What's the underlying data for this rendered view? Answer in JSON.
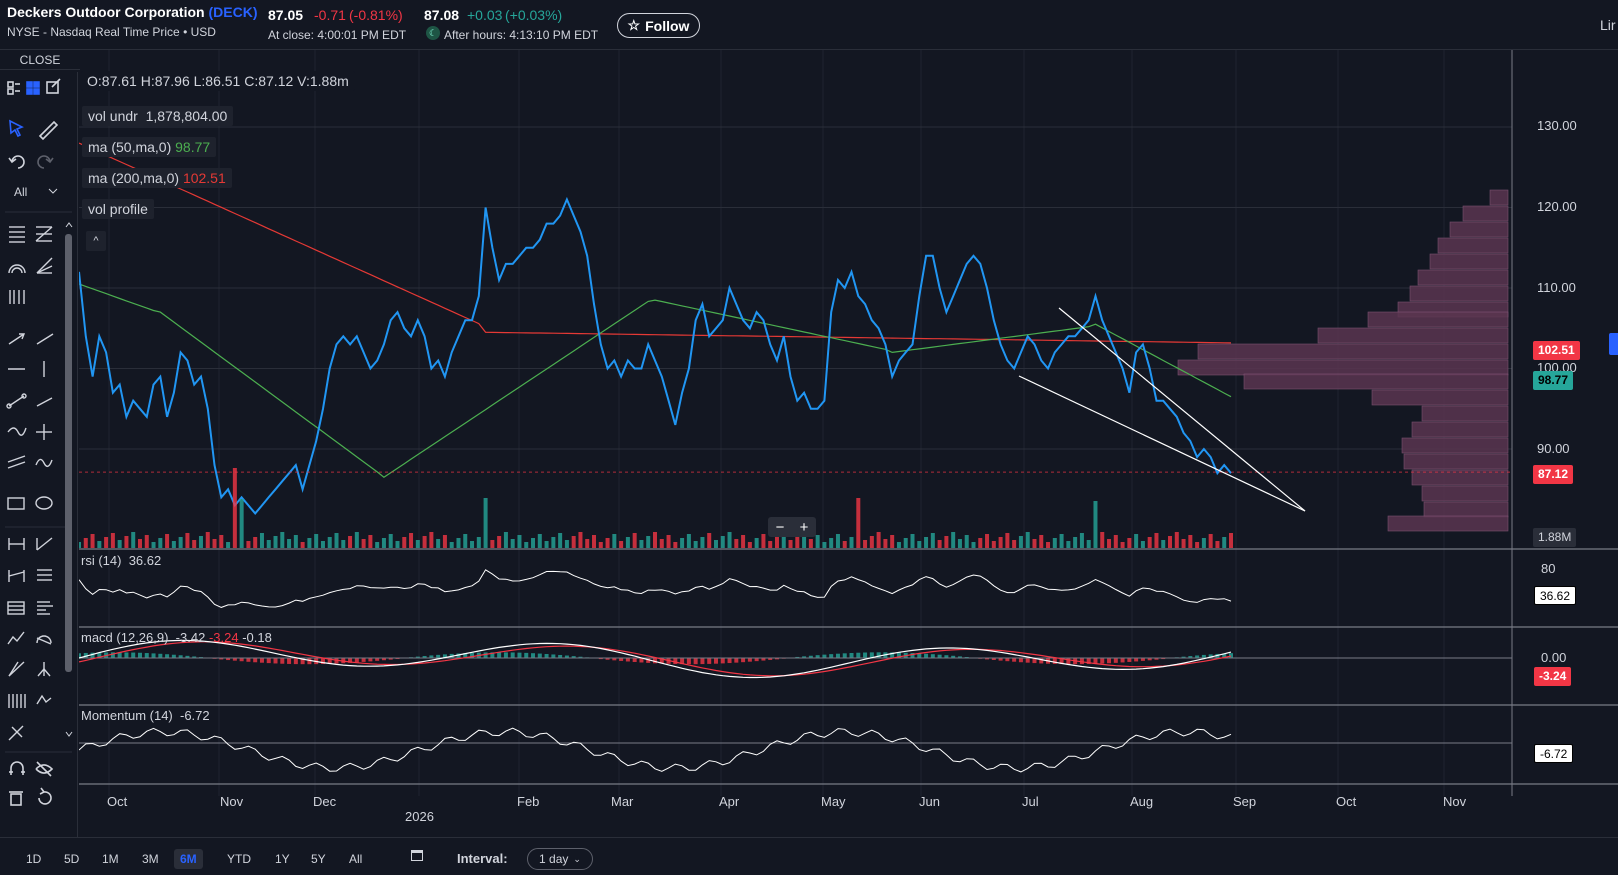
{
  "header": {
    "company": "Deckers Outdoor Corporation",
    "ticker": "(DECK)",
    "exchange": "NYSE - Nasdaq Real Time Price • USD",
    "close_price": "87.05",
    "close_change": "-0.71",
    "close_change_pct": "(-0.81%)",
    "close_time": "At close: 4:00:01 PM EDT",
    "after_price": "87.08",
    "after_change": "+0.03",
    "after_change_pct": "(+0.03%)",
    "after_time": "After hours: 4:13:10 PM EDT",
    "follow_label": "Follow",
    "right_cut": "Lir"
  },
  "sidebar": {
    "close_label": "CLOSE",
    "all_label": "All"
  },
  "legend": {
    "ohlc": "O:87.61  H:87.96  L:86.51  C:87.12  V:1.88m",
    "vol_label": "vol undr",
    "vol_value": "1,878,804.00",
    "ma50_label": "ma (50,ma,0)",
    "ma50_value": "98.77",
    "ma200_label": "ma (200,ma,0)",
    "ma200_value": "102.51",
    "volprofile_label": "vol profile"
  },
  "price_axis": [
    "130.00",
    "120.00",
    "110.00",
    "100.00",
    "90.00"
  ],
  "price_badges": {
    "ma200": "102.51",
    "ma50": "98.77",
    "last": "87.12",
    "volume": "1.88M"
  },
  "rsi": {
    "label": "rsi (14)",
    "value": "36.62",
    "axis_top": "80",
    "badge": "36.62"
  },
  "macd": {
    "label": "macd (12,26,9)",
    "v1": "-3.42",
    "v2": "-3.24",
    "v3": "-0.18",
    "axis": "0.00",
    "badge": "-3.24"
  },
  "momentum": {
    "label": "Momentum (14)",
    "value": "-6.72",
    "badge": "-6.72"
  },
  "zoom": {
    "minus": "−",
    "plus": "+"
  },
  "time_axis": [
    "Oct",
    "Nov",
    "Dec",
    "Feb",
    "Mar",
    "Apr",
    "May",
    "Jun",
    "Jul",
    "Aug",
    "Sep",
    "Oct",
    "Nov"
  ],
  "time_year": "2026",
  "bottom": {
    "ranges": [
      "1D",
      "5D",
      "1M",
      "3M",
      "6M",
      "YTD",
      "1Y",
      "5Y",
      "All"
    ],
    "active_range": "6M",
    "interval_label": "Interval:",
    "interval_value": "1 day"
  },
  "colors": {
    "bg": "#131722",
    "price_line": "#2196f3",
    "ma50": "#4caf50",
    "ma200": "#e53935",
    "up": "#26a69a",
    "down": "#f23645",
    "profile": "#5a3550"
  }
}
